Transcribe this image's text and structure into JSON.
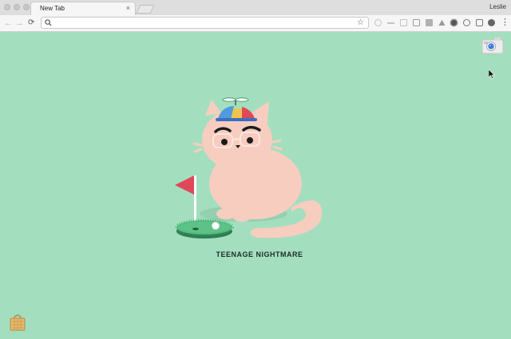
{
  "browser": {
    "tab_title": "New Tab",
    "tab_close": "×",
    "user_name": "Leslie",
    "omnibox_value": ""
  },
  "toolbar": {
    "back_icon": "←",
    "forward_icon": "→",
    "reload_icon": "⟳",
    "bookmark_icon": "☆",
    "menu_icon": "⋮"
  },
  "newtab_page": {
    "artwork_title": "TEENAGE NIGHTMARE",
    "camera_icon": "camera-icon",
    "bag_icon": "shopping-bag-icon"
  },
  "colors": {
    "background": "#a3dfbf",
    "cat": "#f7cdbf",
    "flag": "#e0485a",
    "green": "#3e9f6a"
  }
}
